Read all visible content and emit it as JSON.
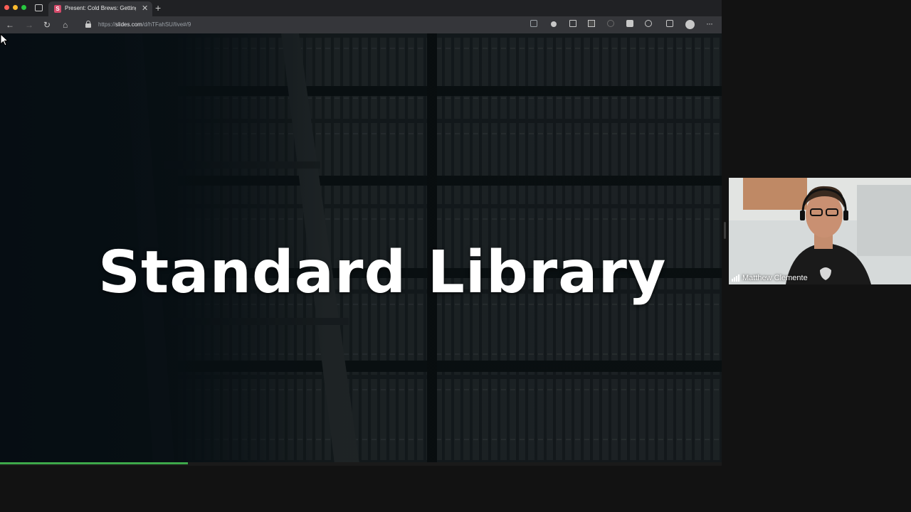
{
  "browser": {
    "tab": {
      "favicon_letter": "S",
      "title": "Present: Cold Brews: Getting"
    },
    "url": {
      "prefix": "https://",
      "host": "slides.com",
      "path": "/d/hTFahSU/live#/9"
    },
    "icons": [
      "back-icon",
      "forward-icon",
      "reload-icon",
      "home-icon",
      "lock-icon",
      "bookmark-icon",
      "extension-icon",
      "profile-icon",
      "menu-icon"
    ]
  },
  "slide": {
    "title": "Standard Library",
    "progress_fraction": 0.26,
    "controls": [
      "previous-slide",
      "next-slide",
      "down-slide"
    ]
  },
  "video": {
    "participant_name": "Matthew Clemente"
  },
  "colors": {
    "accent_progress": "#3ea84a",
    "tab_favicon": "#d44a6a"
  }
}
